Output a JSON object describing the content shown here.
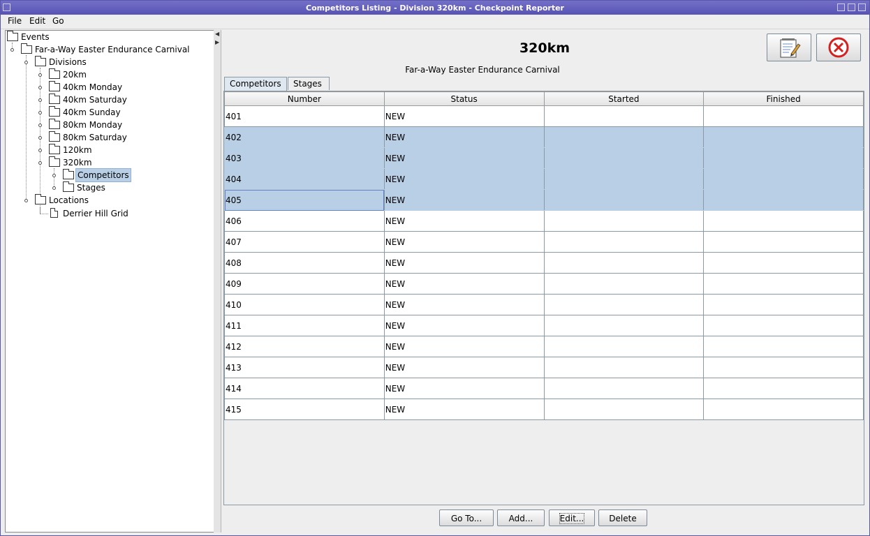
{
  "window": {
    "title": "Competitors Listing - Division 320km - Checkpoint Reporter"
  },
  "menu": {
    "file": "File",
    "edit": "Edit",
    "go": "Go"
  },
  "tree": {
    "root": "Events",
    "event": "Far-a-Way Easter Endurance Carnival",
    "divisions": "Divisions",
    "division_items": [
      "20km",
      "40km Monday",
      "40km Saturday",
      "40km Sunday",
      "80km Monday",
      "80km Saturday",
      "120km",
      "320km"
    ],
    "competitors": "Competitors",
    "stages": "Stages",
    "locations": "Locations",
    "location_items": [
      "Derrier Hill Grid"
    ]
  },
  "header": {
    "title": "320km",
    "subtitle": "Far-a-Way Easter Endurance Carnival"
  },
  "toolbar": {
    "edit_icon": "edit-notepad-icon",
    "close_icon": "close-circle-icon"
  },
  "tabs": [
    "Competitors",
    "Stages"
  ],
  "table": {
    "columns": [
      "Number",
      "Status",
      "Started",
      "Finished"
    ],
    "rows": [
      [
        "401",
        "NEW",
        "",
        ""
      ],
      [
        "402",
        "NEW",
        "",
        ""
      ],
      [
        "403",
        "NEW",
        "",
        ""
      ],
      [
        "404",
        "NEW",
        "",
        ""
      ],
      [
        "405",
        "NEW",
        "",
        ""
      ],
      [
        "406",
        "NEW",
        "",
        ""
      ],
      [
        "407",
        "NEW",
        "",
        ""
      ],
      [
        "408",
        "NEW",
        "",
        ""
      ],
      [
        "409",
        "NEW",
        "",
        ""
      ],
      [
        "410",
        "NEW",
        "",
        ""
      ],
      [
        "411",
        "NEW",
        "",
        ""
      ],
      [
        "412",
        "NEW",
        "",
        ""
      ],
      [
        "413",
        "NEW",
        "",
        ""
      ],
      [
        "414",
        "NEW",
        "",
        ""
      ],
      [
        "415",
        "NEW",
        "",
        ""
      ]
    ],
    "selected_rows": [
      "402",
      "403",
      "404",
      "405"
    ]
  },
  "buttons": {
    "goto": "Go To...",
    "add": "Add...",
    "edit": "Edit...",
    "delete": "Delete"
  },
  "colors": {
    "titlebar": "#5853b3",
    "selection": "#b8cfe5",
    "close_red": "#d42020"
  }
}
